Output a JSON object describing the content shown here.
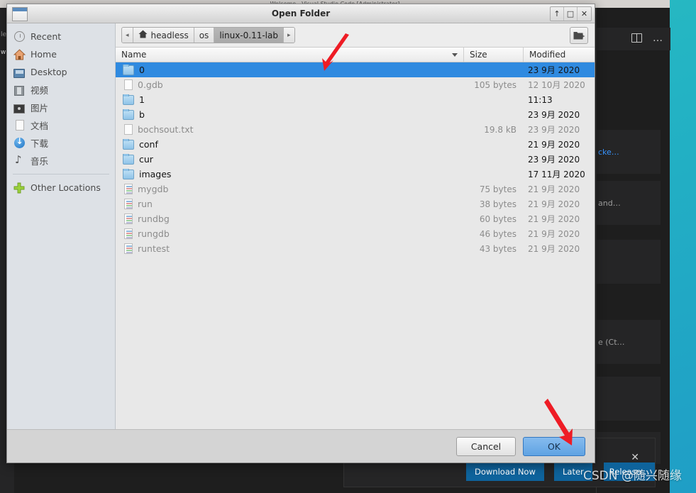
{
  "background": {
    "editor_titlebar": "Welcome - Visual Studio Code [Administrator]",
    "left_strip": {
      "line1": "le",
      "line2": "w"
    },
    "sidebar": {
      "split_icon": "split-editor-icon",
      "more_icon": "…",
      "cards": [
        {
          "text": "cke…"
        },
        {
          "text": "and…"
        },
        {
          "text": ""
        },
        {
          "text": "e (Ct…"
        },
        {
          "text": ""
        },
        {
          "text": ""
        }
      ]
    },
    "toast": {
      "close_label": "✕",
      "buttons": [
        {
          "label": "Download Now"
        },
        {
          "label": "Later"
        },
        {
          "label": "Release…"
        }
      ]
    },
    "watermark": "CSDN @随兴随缘"
  },
  "dialog": {
    "title": "Open Folder",
    "window_controls": [
      {
        "name": "shade-button",
        "glyph": "↑"
      },
      {
        "name": "maximize-button",
        "glyph": "□"
      },
      {
        "name": "close-button",
        "glyph": "✕"
      }
    ],
    "places": [
      {
        "label": "Recent",
        "icon": "clock-icon"
      },
      {
        "label": "Home",
        "icon": "home-icon"
      },
      {
        "label": "Desktop",
        "icon": "desktop-icon"
      },
      {
        "label": "视频",
        "icon": "video-icon"
      },
      {
        "label": "图片",
        "icon": "pictures-icon"
      },
      {
        "label": "文档",
        "icon": "documents-icon"
      },
      {
        "label": "下载",
        "icon": "downloads-icon"
      },
      {
        "label": "音乐",
        "icon": "music-icon"
      }
    ],
    "other_locations": {
      "label": "Other Locations",
      "icon": "plus-icon"
    },
    "breadcrumbs": {
      "back_glyph": "◂",
      "forward_glyph": "▸",
      "items": [
        {
          "label": "headless",
          "icon": "home-icon",
          "active": false
        },
        {
          "label": "os",
          "icon": "",
          "active": false
        },
        {
          "label": "linux-0.11-lab",
          "icon": "",
          "active": true
        }
      ]
    },
    "new_folder_button": "create-folder-icon",
    "columns": {
      "name": "Name",
      "size": "Size",
      "modified": "Modified"
    },
    "files": [
      {
        "name": "0",
        "type": "folder",
        "size": "",
        "modified": "23 9月 2020",
        "selected": true
      },
      {
        "name": "0.gdb",
        "type": "doc",
        "size": "105 bytes",
        "modified": "12 10月 2020",
        "selected": false
      },
      {
        "name": "1",
        "type": "folder",
        "size": "",
        "modified": "11:13",
        "selected": false
      },
      {
        "name": "b",
        "type": "folder",
        "size": "",
        "modified": "23 9月 2020",
        "selected": false
      },
      {
        "name": "bochsout.txt",
        "type": "doc",
        "size": "19.8 kB",
        "modified": "23 9月 2020",
        "selected": false
      },
      {
        "name": "conf",
        "type": "folder",
        "size": "",
        "modified": "21 9月 2020",
        "selected": false
      },
      {
        "name": "cur",
        "type": "folder",
        "size": "",
        "modified": "23 9月 2020",
        "selected": false
      },
      {
        "name": "images",
        "type": "folder",
        "size": "",
        "modified": "17 11月 2020",
        "selected": false
      },
      {
        "name": "mygdb",
        "type": "script",
        "size": "75 bytes",
        "modified": "21 9月 2020",
        "selected": false
      },
      {
        "name": "run",
        "type": "script",
        "size": "38 bytes",
        "modified": "21 9月 2020",
        "selected": false
      },
      {
        "name": "rundbg",
        "type": "script",
        "size": "60 bytes",
        "modified": "21 9月 2020",
        "selected": false
      },
      {
        "name": "rungdb",
        "type": "script",
        "size": "46 bytes",
        "modified": "21 9月 2020",
        "selected": false
      },
      {
        "name": "runtest",
        "type": "script",
        "size": "43 bytes",
        "modified": "21 9月 2020",
        "selected": false
      }
    ],
    "buttons": {
      "cancel": "Cancel",
      "ok": "OK"
    }
  },
  "annotations": {
    "arrow_color": "#ee1c25",
    "arrows": [
      {
        "name": "arrow-to-file-list"
      },
      {
        "name": "arrow-to-ok-button"
      }
    ]
  }
}
